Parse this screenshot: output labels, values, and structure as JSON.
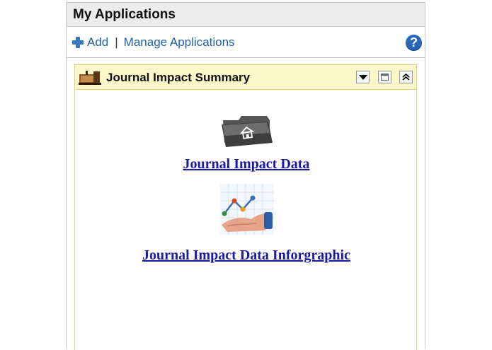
{
  "panel": {
    "title": "My Applications",
    "toolbar": {
      "add_label": "Add",
      "separator": "|",
      "manage_label": "Manage Applications",
      "help_label": "?"
    }
  },
  "portlet": {
    "title": "Journal Impact Summary",
    "links": [
      {
        "label": "Journal Impact Data",
        "icon": "folder-home-icon"
      },
      {
        "label": "Journal Impact Data Inforgraphic",
        "icon": "chart-hand-icon"
      }
    ]
  },
  "colors": {
    "link_blue": "#1f5fa6",
    "app_link": "#1a1aa6",
    "portlet_header_bg": "#fcf7c9",
    "portlet_border": "#e6d27a",
    "panel_header_bg": "#ececec"
  }
}
